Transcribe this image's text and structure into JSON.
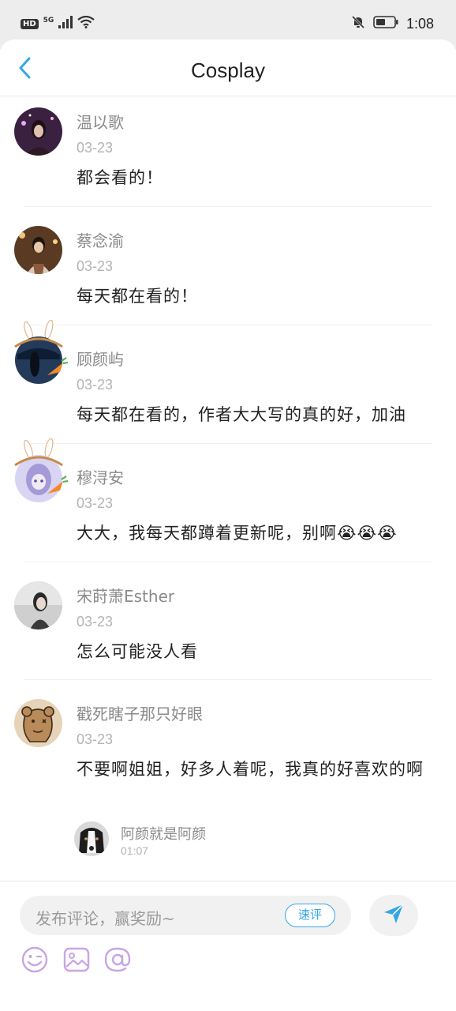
{
  "status_bar": {
    "hd": "HD",
    "network": "5G",
    "time": "1:08"
  },
  "header": {
    "title": "Cosplay"
  },
  "comments": [
    {
      "name": "温以歌",
      "date": "03-23",
      "text": "都会看的！"
    },
    {
      "name": "蔡念渝",
      "date": "03-23",
      "text": "每天都在看的！"
    },
    {
      "name": "顾颜屿",
      "date": "03-23",
      "text": "每天都在看的，作者大大写的真的好，加油"
    },
    {
      "name": "穆浔安",
      "date": "03-23",
      "text": "大大，我每天都蹲着更新呢，别啊😭😭😭"
    },
    {
      "name": "宋莳萧Esther",
      "date": "03-23",
      "text": "怎么可能没人看"
    },
    {
      "name": "戳死瞎子那只好眼",
      "date": "03-23",
      "text": "不要啊姐姐，好多人着呢，我真的好喜欢的啊"
    }
  ],
  "reply": {
    "name": "阿颜就是阿颜",
    "time": "01:07"
  },
  "composer": {
    "placeholder": "发布评论，赢奖励~",
    "quick_label": "速评"
  },
  "icons": [
    "back-icon",
    "send-icon",
    "emoji-icon",
    "image-icon",
    "mention-icon"
  ],
  "colors": {
    "accent": "#35a7e6",
    "toolbar_icon": "#c9a5e3"
  }
}
